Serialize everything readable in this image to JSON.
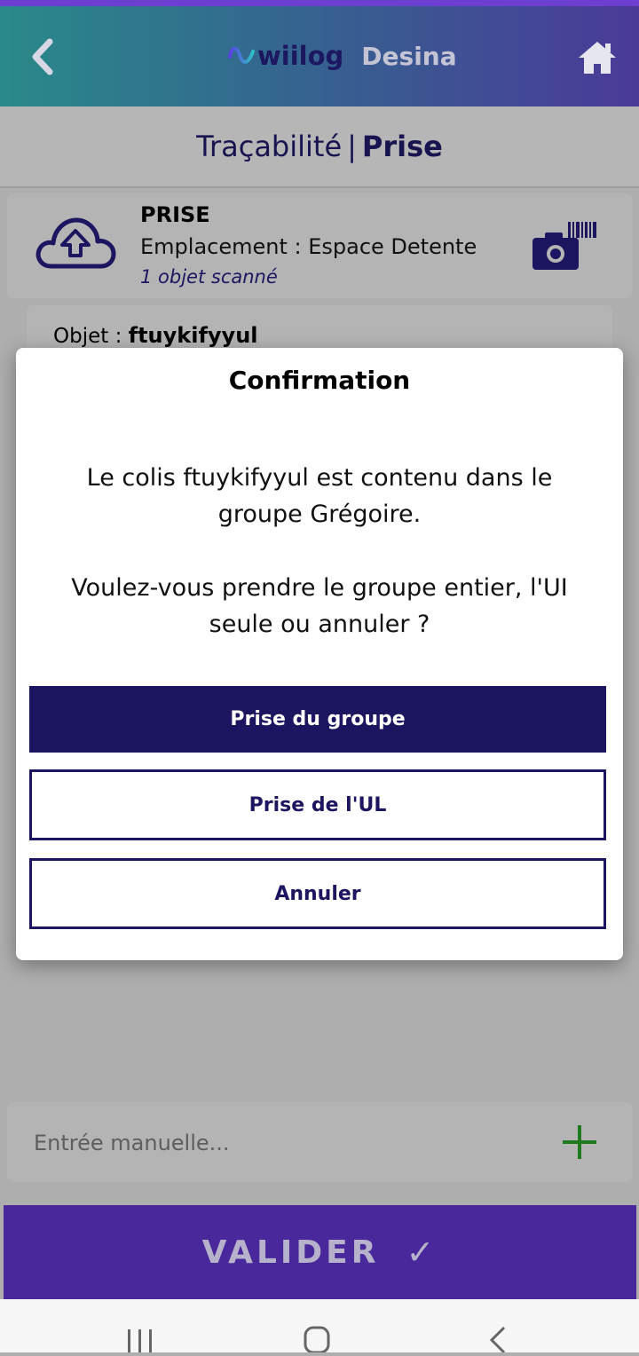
{
  "header": {
    "logo_text": "wiilog",
    "site_name": "Desina",
    "back_icon": "chevron-left-icon",
    "home_icon": "home-icon",
    "gradient_start": "#2a8a8a",
    "gradient_end": "#4a3a98"
  },
  "titlebar": {
    "section": "Traçabilité",
    "separator": "|",
    "mode": "Prise"
  },
  "summary": {
    "title": "PRISE",
    "location": "Emplacement : Espace Detente",
    "count": "1 objet scanné",
    "upload_icon": "cloud-upload-icon",
    "scan_icon": "camera-barcode-icon"
  },
  "object": {
    "label": "Objet : ",
    "value": "ftuykifyyul"
  },
  "modal": {
    "title": "Confirmation",
    "message_line1": "Le colis ftuykifyyul est contenu dans le groupe Grégoire.",
    "message_line2": "Voulez-vous prendre le groupe entier, l'UI seule ou annuler ?",
    "btn_group": "Prise du groupe",
    "btn_ul": "Prise de l'UL",
    "btn_cancel": "Annuler",
    "primary_color": "#1c1560"
  },
  "manual_entry": {
    "placeholder": "Entrée manuelle...",
    "add_icon": "plus-icon",
    "add_color": "#1f7a1f"
  },
  "validate": {
    "label": "VALIDER",
    "check": "✓",
    "color": "#48289a"
  },
  "system_nav": {
    "recent_icon": "recent-apps-icon",
    "home_icon": "home-circle-icon",
    "back_icon": "back-icon"
  }
}
